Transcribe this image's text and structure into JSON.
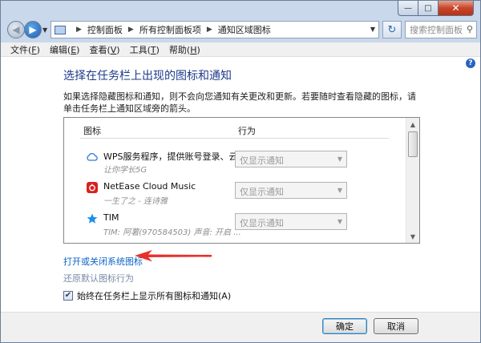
{
  "window": {
    "close_glyph": "✕",
    "min_glyph": "—",
    "max_glyph": "□"
  },
  "nav": {
    "breadcrumb": [
      "控制面板",
      "所有控制面板项",
      "通知区域图标"
    ],
    "search_placeholder": "搜索控制面板"
  },
  "menu": [
    {
      "label": "文件",
      "key": "F"
    },
    {
      "label": "编辑",
      "key": "E"
    },
    {
      "label": "查看",
      "key": "V"
    },
    {
      "label": "工具",
      "key": "T"
    },
    {
      "label": "帮助",
      "key": "H"
    }
  ],
  "main": {
    "heading": "选择在任务栏上出现的图标和通知",
    "description": "如果选择隐藏图标和通知，则不会向您通知有关更改和更新。若要随时查看隐藏的图标，请单击任务栏上通知区域旁的箭头。",
    "columns": {
      "icon": "图标",
      "behavior": "行为"
    },
    "rows": [
      {
        "name": "WPS服务程序，提供账号登录、云...",
        "sub": "让你学长5G",
        "behavior": "仅显示通知",
        "icon": "cloud-icon"
      },
      {
        "name": "NetEase Cloud Music",
        "sub": "一生了之 - 连诗雅",
        "behavior": "仅显示通知",
        "icon": "netease-music-icon"
      },
      {
        "name": "TIM",
        "sub": "TIM: 阿薯(970584503)  声音: 开启 ...",
        "behavior": "仅显示通知",
        "icon": "tim-icon"
      }
    ],
    "link_system_icons": "打开或关闭系统图标",
    "link_restore": "还原默认图标行为",
    "checkbox_label": "始终在任务栏上显示所有图标和通知(A)",
    "checkbox_checked": true
  },
  "footer": {
    "ok": "确定",
    "cancel": "取消"
  },
  "colors": {
    "heading": "#1e3a8a",
    "link": "#0b63c9",
    "arrow": "#e8312b",
    "close": "#c9452a"
  }
}
